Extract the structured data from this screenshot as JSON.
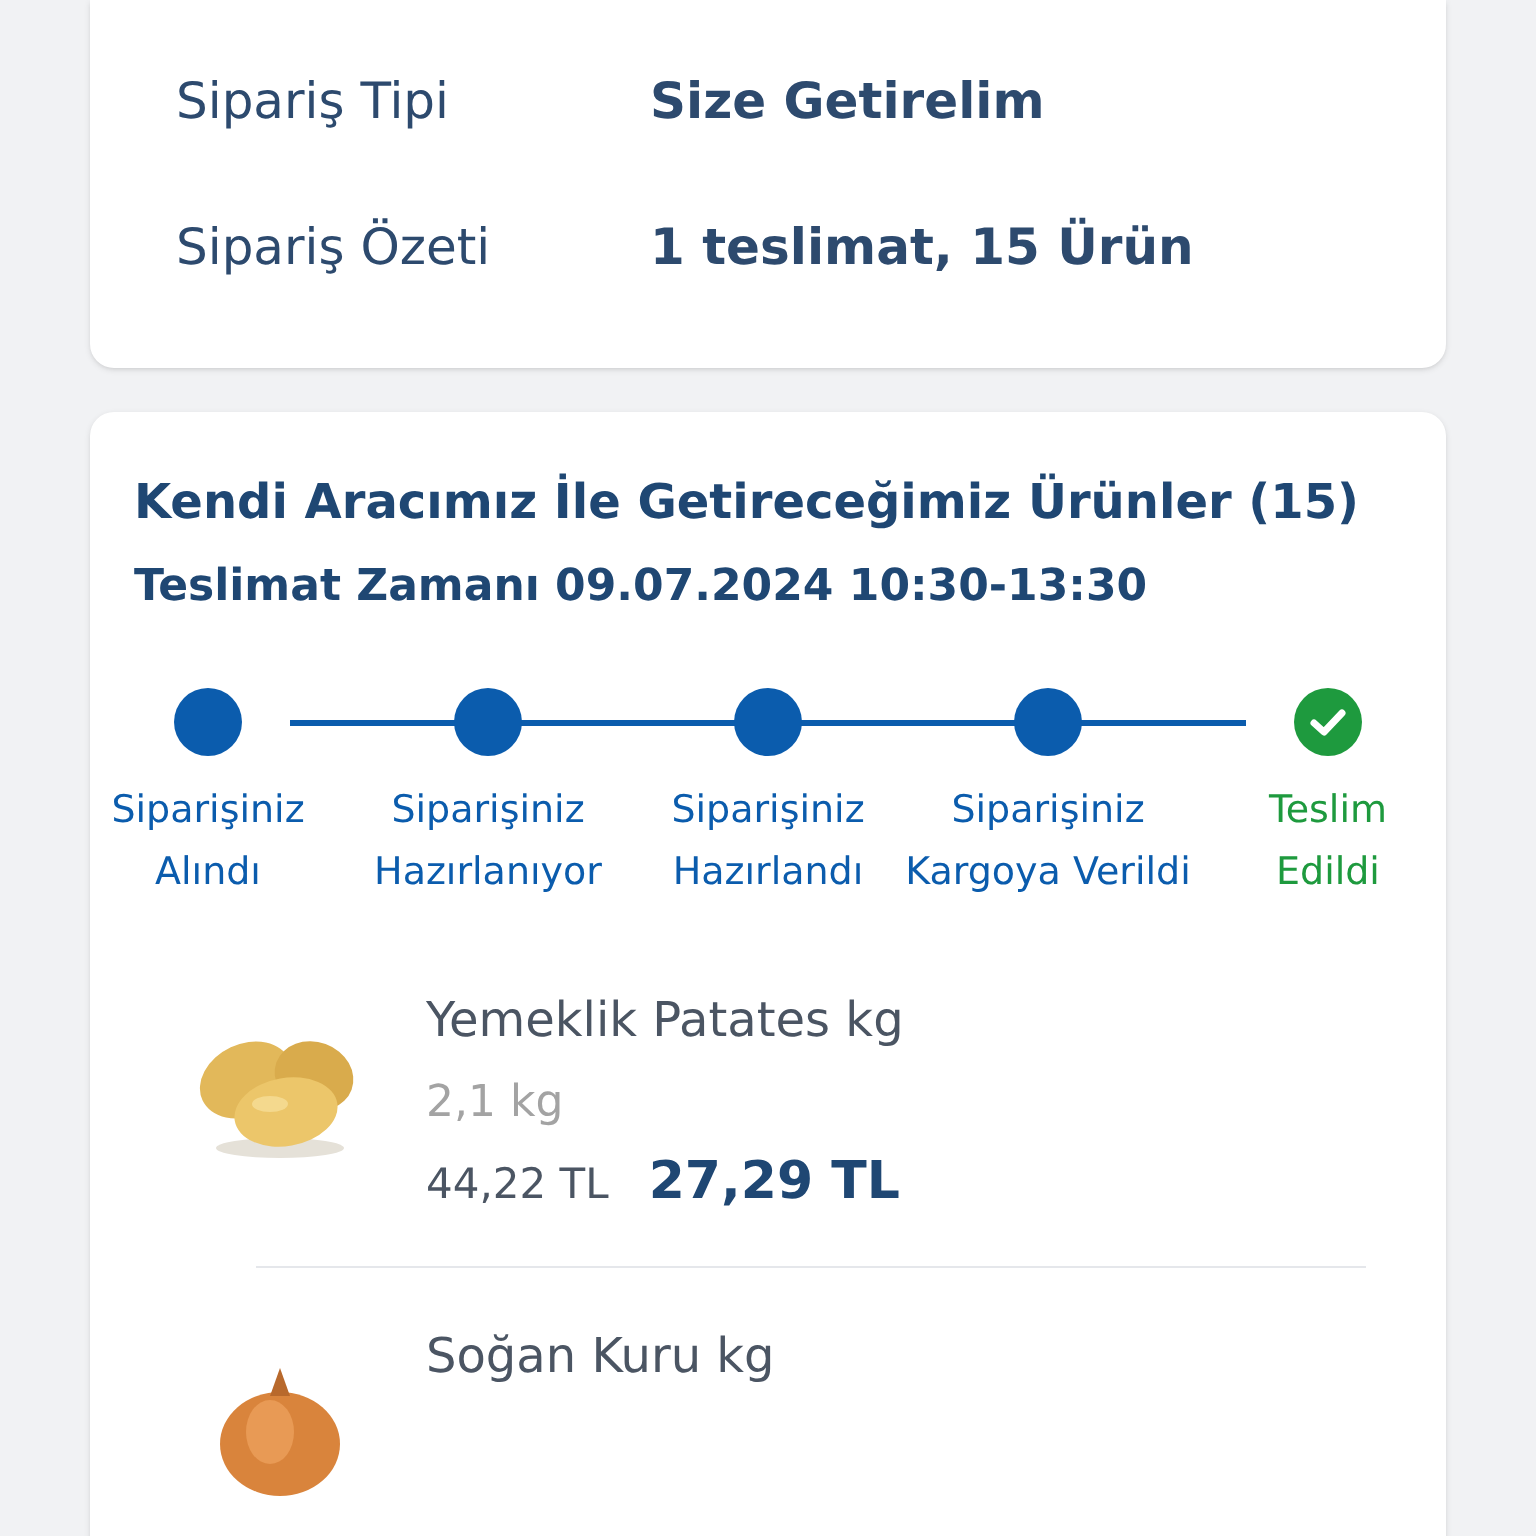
{
  "order_info": [
    {
      "label": "Sipariş Tipi",
      "value": "Size Getirelim"
    },
    {
      "label": "Sipariş Özeti",
      "value": "1 teslimat, 15 Ürün"
    }
  ],
  "delivery": {
    "title": "Kendi Aracımız İle Getireceğimiz Ürünler (15)",
    "time": "Teslimat Zamanı 09.07.2024 10:30-13:30",
    "steps": [
      {
        "line1": "Siparişiniz",
        "line2": "Alındı",
        "kind": "passed"
      },
      {
        "line1": "Siparişiniz",
        "line2": "Hazırlanıyor",
        "kind": "passed"
      },
      {
        "line1": "Siparişiniz",
        "line2": "Hazırlandı",
        "kind": "passed"
      },
      {
        "line1": "Siparişiniz",
        "line2": "Kargoya Verildi",
        "kind": "passed"
      },
      {
        "line1": "Teslim",
        "line2": "Edildi",
        "kind": "done"
      }
    ],
    "products": [
      {
        "name": "Yemeklik Patates kg",
        "quantity": "2,1 kg",
        "old_price": "44,22 TL",
        "price": "27,29 TL",
        "kind": "picture"
      },
      {
        "name": "Soğan Kuru kg",
        "kind": "picture"
      }
    ]
  }
}
